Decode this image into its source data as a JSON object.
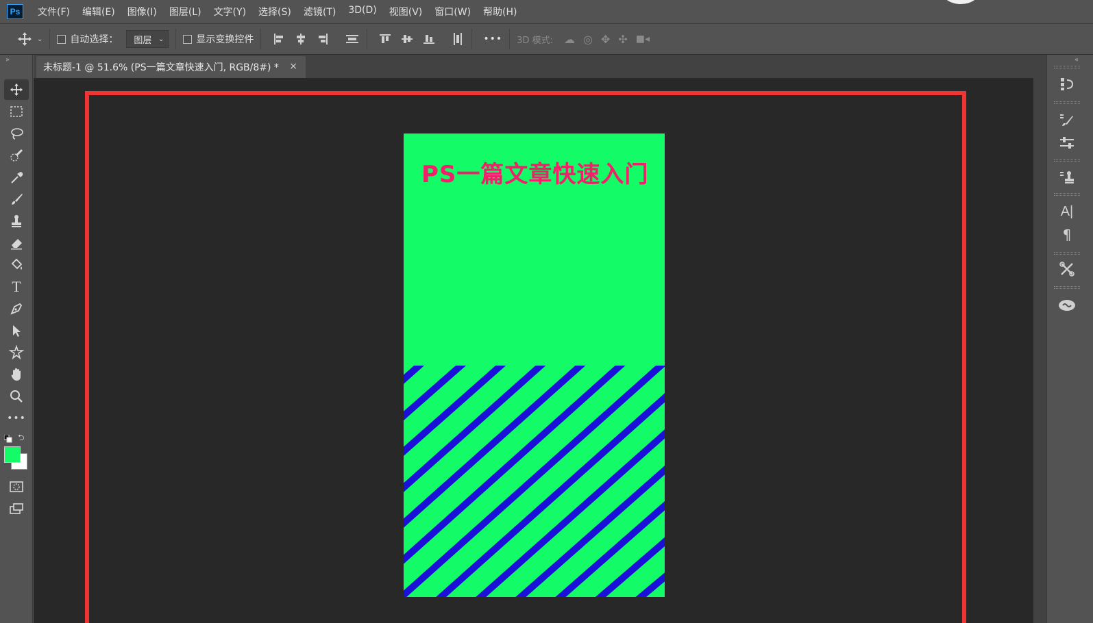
{
  "app": {
    "logo": "Ps"
  },
  "menu": [
    "文件(F)",
    "编辑(E)",
    "图像(I)",
    "图层(L)",
    "文字(Y)",
    "选择(S)",
    "滤镜(T)",
    "3D(D)",
    "视图(V)",
    "窗口(W)",
    "帮助(H)"
  ],
  "options": {
    "auto_select_label": "自动选择：",
    "auto_select_value": "图层",
    "show_transform_label": "显示变换控件",
    "more": "•••",
    "mode3d_label": "3D 模式:"
  },
  "document": {
    "tab_title": "未标题-1 @ 51.6% (PS一篇文章快速入门, RGB/8#) *",
    "close": "×",
    "poster_text": "PS一篇文章快速入门"
  },
  "colors": {
    "foreground": "#13fb67",
    "background": "#ffffff",
    "poster_bg": "#13fb67",
    "stripe": "#1a10d8",
    "title": "#f0206a",
    "selection_border": "#ef3534"
  },
  "tools": [
    "move-tool",
    "marquee-tool",
    "lasso-tool",
    "quick-select-tool",
    "eyedropper-tool",
    "brush-tool",
    "stamp-tool",
    "eraser-tool",
    "paint-bucket-tool",
    "type-tool",
    "pen-tool",
    "path-select-tool",
    "shape-tool",
    "hand-tool",
    "zoom-tool",
    "more-tools"
  ],
  "dock": {
    "type_label": "A|",
    "para_label": "¶"
  }
}
